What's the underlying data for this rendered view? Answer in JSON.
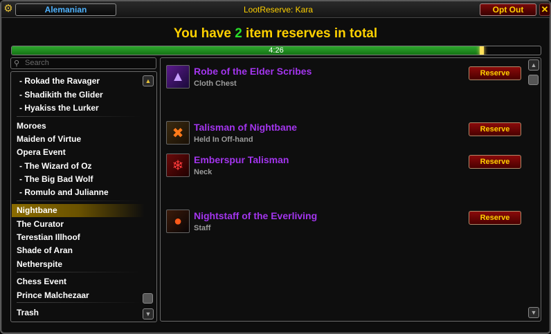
{
  "titlebar": {
    "character": "Alemanian",
    "title": "LootReserve:  Kara",
    "opt_out_label": "Opt Out",
    "close_glyph": "✕",
    "gear_glyph": "⚙"
  },
  "header": {
    "prefix": "You have ",
    "count": "2",
    "suffix": " item reserves in total",
    "count_color": "#2adf2a"
  },
  "timer": {
    "text": "4:26",
    "progress": 0.89
  },
  "search": {
    "placeholder": "Search"
  },
  "bosses": [
    {
      "label": "- Rokad the Ravager",
      "sub": true
    },
    {
      "label": "- Shadikith the Glider",
      "sub": true
    },
    {
      "label": "- Hyakiss the Lurker",
      "sub": true
    },
    {
      "label": "Moroes",
      "sub": false
    },
    {
      "label": "Maiden of Virtue",
      "sub": false
    },
    {
      "label": "Opera Event",
      "sub": false
    },
    {
      "label": "- The Wizard of Oz",
      "sub": true
    },
    {
      "label": "- The Big Bad Wolf",
      "sub": true
    },
    {
      "label": "- Romulo and Julianne",
      "sub": true
    },
    {
      "label": "Nightbane",
      "sub": false,
      "selected": true
    },
    {
      "label": "The Curator",
      "sub": false
    },
    {
      "label": "Terestian Illhoof",
      "sub": false
    },
    {
      "label": "Shade of Aran",
      "sub": false
    },
    {
      "label": "Netherspite",
      "sub": false
    },
    {
      "label": "Chess Event",
      "sub": false
    },
    {
      "label": "Prince Malchezaar",
      "sub": false
    },
    {
      "label": "Trash",
      "sub": false
    }
  ],
  "items": [
    {
      "name": "Robe of the Elder Scribes",
      "slot": "Cloth Chest",
      "button": "Reserve",
      "icon": "robe-icon"
    },
    {
      "name": "Talisman of Nightbane",
      "slot": "Held In Off-hand",
      "button": "Reserve",
      "icon": "talisman-icon"
    },
    {
      "name": "Emberspur Talisman",
      "slot": "Neck",
      "button": "Reserve",
      "icon": "amulet-icon"
    },
    {
      "name": "Nightstaff of the Everliving",
      "slot": "Staff",
      "button": "Reserve",
      "icon": "staff-icon"
    }
  ],
  "colors": {
    "epic": "#a335ee",
    "gold": "#ffd100",
    "class_mage": "#4fb3ff"
  }
}
